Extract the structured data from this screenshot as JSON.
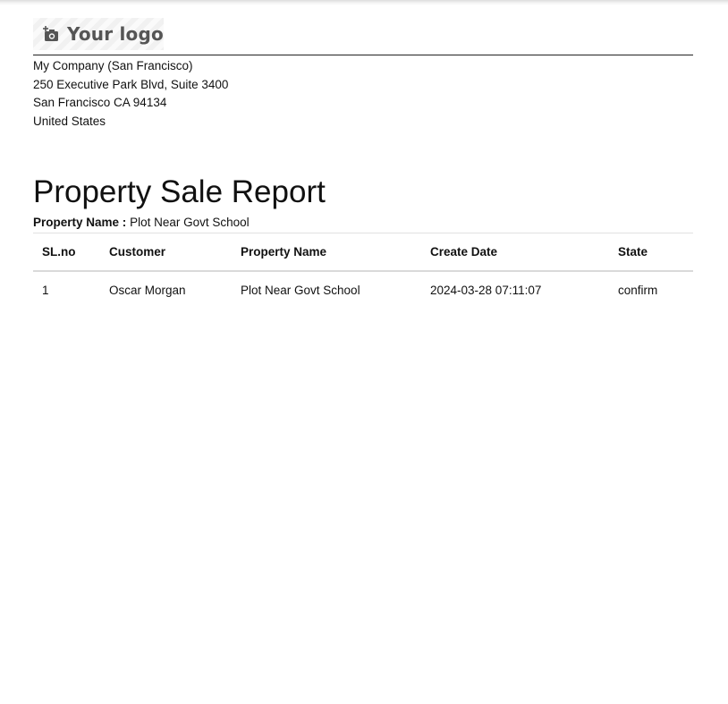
{
  "header": {
    "logo": {
      "icon": "camera-plus-icon",
      "text": "Your logo"
    },
    "company_address": [
      "My Company (San Francisco)",
      "250 Executive Park Blvd, Suite 3400",
      "San Francisco CA 94134",
      "United States"
    ]
  },
  "report": {
    "title": "Property Sale Report",
    "property_label": "Property Name :",
    "property_value": "Plot Near Govt School",
    "table": {
      "columns": [
        "SL.no",
        "Customer",
        "Property Name",
        "Create Date",
        "State"
      ],
      "rows": [
        [
          "1",
          "Oscar Morgan",
          "Plot Near Govt School",
          "2024-03-28 07:11:07",
          "confirm"
        ]
      ]
    }
  }
}
